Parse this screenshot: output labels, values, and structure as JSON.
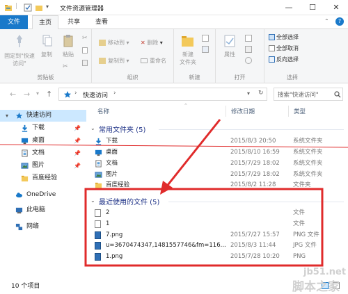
{
  "window": {
    "title": "文件资源管理器",
    "min_glyph": "—",
    "max_glyph": "☐",
    "close_glyph": "✕"
  },
  "ribbon_tabs": {
    "file": "文件",
    "home": "主页",
    "share": "共享",
    "view": "查看"
  },
  "ribbon": {
    "clipboard": {
      "label": "剪贴板",
      "pin": "固定到\"快速访问\"",
      "copy": "复制",
      "paste": "粘贴"
    },
    "organize": {
      "label": "组织",
      "move_to": "移动到",
      "copy_to": "复制到",
      "delete": "删除",
      "rename": "重命名"
    },
    "new": {
      "label": "新建",
      "new_folder": "新建\n文件夹"
    },
    "open": {
      "label": "打开",
      "properties": "属性"
    },
    "select": {
      "label": "选择",
      "select_all": "全部选择",
      "select_none": "全部取消",
      "invert": "反向选择"
    }
  },
  "address": {
    "path": "快速访问",
    "separator": "›",
    "search_placeholder": "搜索\"快速访问\""
  },
  "sidebar": {
    "items": [
      {
        "label": "快速访问"
      },
      {
        "label": "下载"
      },
      {
        "label": "桌面"
      },
      {
        "label": "文档"
      },
      {
        "label": "图片"
      },
      {
        "label": "百度经验"
      },
      {
        "label": "OneDrive"
      },
      {
        "label": "此电脑"
      },
      {
        "label": "网络"
      }
    ]
  },
  "columns": {
    "name": "名称",
    "date": "修改日期",
    "type": "类型"
  },
  "groups": {
    "frequent": "常用文件夹 (5)",
    "recent": "最近使用的文件 (5)"
  },
  "frequent": [
    {
      "name": "下载",
      "date": "2015/8/3 20:50",
      "type": "系统文件夹"
    },
    {
      "name": "桌面",
      "date": "2015/8/10 16:59",
      "type": "系统文件夹"
    },
    {
      "name": "文档",
      "date": "2015/7/29 18:02",
      "type": "系统文件夹"
    },
    {
      "name": "图片",
      "date": "2015/7/29 18:02",
      "type": "系统文件夹"
    },
    {
      "name": "百度经验",
      "date": "2015/8/2 11:28",
      "type": "文件夹"
    }
  ],
  "recent": [
    {
      "name": "2",
      "date": "",
      "type": "文件"
    },
    {
      "name": "1",
      "date": "",
      "type": "文件"
    },
    {
      "name": "7.png",
      "date": "2015/7/27 15:57",
      "type": "PNG 文件"
    },
    {
      "name": "u=3670474347,1481557746&fm=116...",
      "date": "2015/8/3 11:44",
      "type": "JPG 文件"
    },
    {
      "name": "1.png",
      "date": "2015/7/28 10:20",
      "type": "PNG"
    }
  ],
  "status": {
    "count": "10 个项目"
  },
  "watermark": {
    "line1": "jb51.net",
    "line2": "脚本之家"
  },
  "colors": {
    "accent": "#1979ca",
    "annotation": "#e02b2b",
    "selected": "#cce8ff",
    "group_header": "#1e3287"
  }
}
